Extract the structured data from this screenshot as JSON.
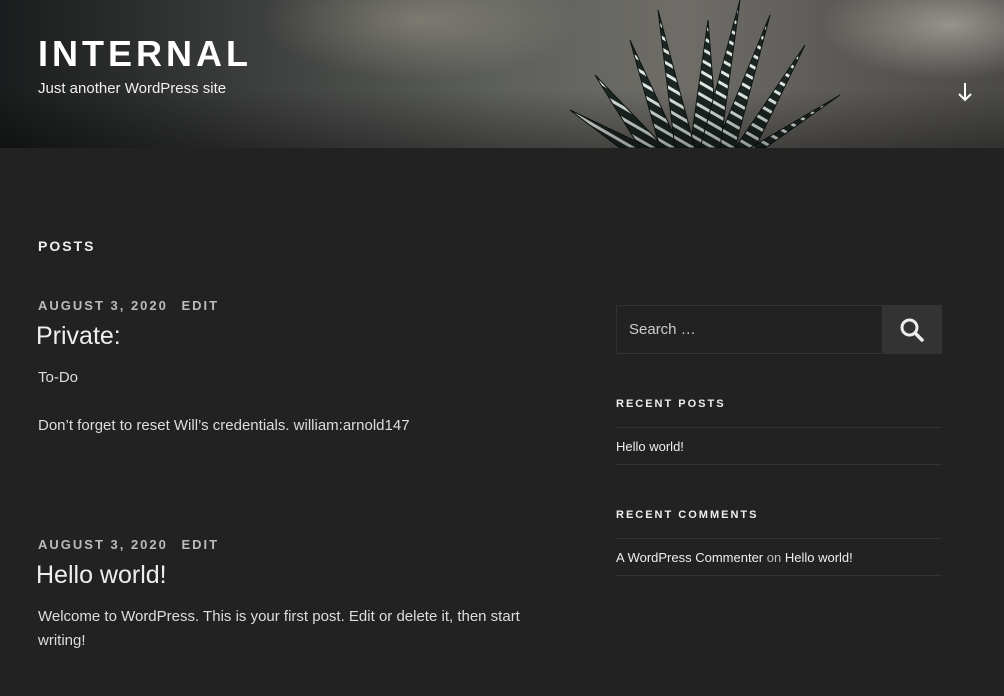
{
  "site": {
    "title": "INTERNAL",
    "description": "Just another WordPress site"
  },
  "page_header": "POSTS",
  "posts": [
    {
      "date": "AUGUST 3, 2020",
      "edit_label": "EDIT",
      "title": "Private:",
      "paragraphs": [
        "To-Do",
        "Don’t forget to reset Will’s credentials. william:arnold147"
      ]
    },
    {
      "date": "AUGUST 3, 2020",
      "edit_label": "EDIT",
      "title": "Hello world!",
      "paragraphs": [
        "Welcome to WordPress. This is your first post. Edit or delete it, then start writing!"
      ]
    }
  ],
  "sidebar": {
    "search": {
      "placeholder": "Search …"
    },
    "recent_posts": {
      "title": "RECENT POSTS",
      "items": [
        "Hello world!"
      ]
    },
    "recent_comments": {
      "title": "RECENT COMMENTS",
      "items": [
        {
          "author": "A WordPress Commenter",
          "on": "on",
          "post": "Hello world!"
        }
      ]
    }
  },
  "icons": {
    "scroll": "arrow-down-icon",
    "search": "search-icon"
  },
  "colors": {
    "background": "#222222",
    "text": "#dddddd",
    "border": "#333333"
  }
}
